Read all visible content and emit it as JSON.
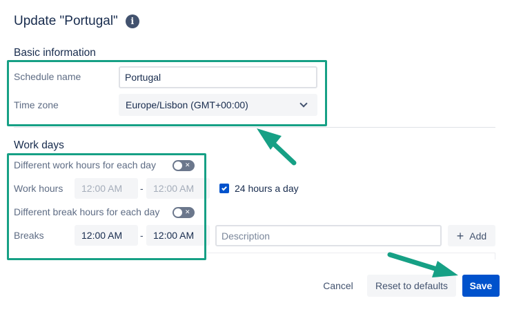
{
  "dialog": {
    "title": "Update \"Portugal\"",
    "info_icon": "info-icon"
  },
  "basic_info": {
    "heading": "Basic information",
    "schedule_name_label": "Schedule name",
    "schedule_name_value": "Portugal",
    "time_zone_label": "Time zone",
    "time_zone_value": "Europe/Lisbon (GMT+00:00)"
  },
  "work_days": {
    "heading": "Work days",
    "different_work_hours_label": "Different work hours for each day",
    "different_work_hours_on": false,
    "work_hours_label": "Work hours",
    "work_hours_start": "12:00 AM",
    "work_hours_end": "12:00 AM",
    "separator": "-",
    "all_day_checked": true,
    "all_day_label": "24 hours a day",
    "different_break_hours_label": "Different break hours for each day",
    "different_break_hours_on": false,
    "breaks_label": "Breaks",
    "breaks_start": "12:00 AM",
    "breaks_end": "12:00 AM",
    "description_placeholder": "Description",
    "add_label": "Add"
  },
  "footer": {
    "cancel_label": "Cancel",
    "reset_label": "Reset to defaults",
    "save_label": "Save"
  },
  "colors": {
    "primary": "#0052cc",
    "annotation": "#16a085",
    "toggle_off": "#6b778c"
  }
}
